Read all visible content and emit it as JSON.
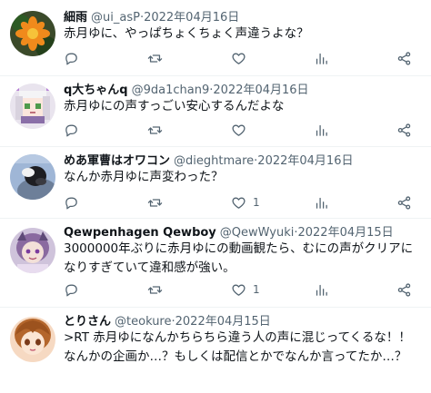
{
  "tweets": [
    {
      "name": "細雨",
      "handle": "@ui_asP",
      "separator": "·",
      "date": "2022年04月16日",
      "text": "赤月ゆに、やっぱちょくちょく声違うよな？",
      "reply_count": "",
      "retweet_count": "",
      "like_count": ""
    },
    {
      "name": "q大ちゃんq",
      "handle": "@9da1chan9",
      "separator": "·",
      "date": "2022年04月16日",
      "text": "赤月ゆにの声すっごい安心するんだよな",
      "reply_count": "",
      "retweet_count": "",
      "like_count": ""
    },
    {
      "name": "めあ軍曹はオワコン",
      "handle": "@dieghtmare",
      "separator": "·",
      "date": "2022年04月16日",
      "text": "なんか赤月ゆに声変わった？",
      "reply_count": "",
      "retweet_count": "",
      "like_count": "1"
    },
    {
      "name": "Qewpenhagen Qewboy",
      "handle": "@QewWyuki",
      "separator": "·",
      "date": "2022年04月15日",
      "text": "3000000年ぶりに赤月ゆにの動画観たら、むにの声がクリアになりすぎていて違和感が強い。",
      "reply_count": "",
      "retweet_count": "",
      "like_count": "1"
    },
    {
      "name": "とりさん",
      "handle": "@teokure",
      "separator": "·",
      "date": "2022年04月15日",
      "text": ">RT 赤月ゆになんかちらちら違う人の声に混じってくるな！！\nなんかの企画か…？もしくは配信とかでなんか言ってたか…？",
      "reply_count": "",
      "retweet_count": "",
      "like_count": ""
    }
  ],
  "icons": {
    "reply": "reply-icon",
    "retweet": "retweet-icon",
    "like": "heart-icon",
    "views": "views-icon",
    "share": "share-icon"
  },
  "colors": {
    "text": "#0f1419",
    "secondary": "#536471",
    "divider": "#eff3f4"
  }
}
